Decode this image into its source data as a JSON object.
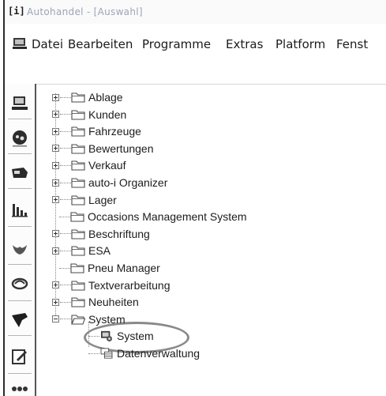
{
  "window": {
    "app_icon": "[i]",
    "title": "Autohandel - [Auswahl]"
  },
  "menu": {
    "items": [
      "Datei",
      "Bearbeiten",
      "Programme",
      "Extras",
      "Platform",
      "Fenst"
    ]
  },
  "sidebar": {
    "icons": [
      "computer-icon",
      "face-icon",
      "car-icon",
      "bar-chart-icon",
      "bird-icon",
      "swirl-icon",
      "bull-icon",
      "edit-icon",
      "network-icon"
    ]
  },
  "tree": {
    "nodes": [
      {
        "label": "Ablage",
        "expander": "plus"
      },
      {
        "label": "Kunden",
        "expander": "plus"
      },
      {
        "label": "Fahrzeuge",
        "expander": "plus"
      },
      {
        "label": "Bewertungen",
        "expander": "plus"
      },
      {
        "label": "Verkauf",
        "expander": "plus"
      },
      {
        "label": "auto-i Organizer",
        "expander": "plus"
      },
      {
        "label": "Lager",
        "expander": "plus"
      },
      {
        "label": "Occasions Management System",
        "expander": "none"
      },
      {
        "label": "Beschriftung",
        "expander": "plus"
      },
      {
        "label": "ESA",
        "expander": "plus"
      },
      {
        "label": "Pneu Manager",
        "expander": "none"
      },
      {
        "label": "Textverarbeitung",
        "expander": "plus"
      },
      {
        "label": "Neuheiten",
        "expander": "plus"
      },
      {
        "label": "System",
        "expander": "minus"
      }
    ],
    "children": [
      {
        "label": "System",
        "icon": "system-gear-icon"
      },
      {
        "label": "Datenverwaltung",
        "icon": "database-icon"
      }
    ]
  },
  "colors": {
    "title_text": "#9aa4b8",
    "folder_fill": "#ffffff",
    "highlight": "#8a8a8a"
  }
}
